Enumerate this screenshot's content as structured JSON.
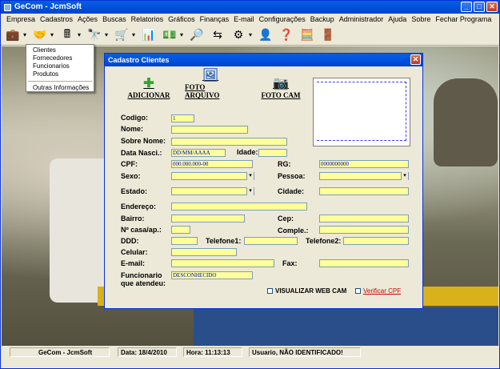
{
  "window": {
    "title": "GeCom - JcmSoft"
  },
  "menubar": [
    "Empresa",
    "Cadastros",
    "Ações",
    "Buscas",
    "Relatorios",
    "Gráficos",
    "Finanças",
    "E-mail",
    "Configurações",
    "Backup",
    "Administrador",
    "Ajuda",
    "Sobre",
    "Fechar Programa"
  ],
  "toolbar_icons": [
    "briefcase-icon",
    "handshake-icon",
    "cash-register-icon",
    "binoculars-icon",
    "cart-icon",
    "chart-icon",
    "money-icon",
    "search-people-icon",
    "transfer-icon",
    "settings-icon",
    "user-card-icon",
    "help-icon",
    "calculator-icon",
    "exit-door-icon"
  ],
  "cadastros_menu": {
    "items": [
      "Clientes",
      "Fornecedores",
      "Funcionarios",
      "Produtos"
    ],
    "extra": "Outras Informações"
  },
  "dialog": {
    "title": "Cadastro Clientes",
    "buttons": {
      "add": "ADICIONAR",
      "photo_file": "FOTO ARQUIVO",
      "photo_cam": "FOTO CAM"
    },
    "labels": {
      "codigo": "Codigo:",
      "nome": "Nome:",
      "sobrenome": "Sobre Nome:",
      "data_nasc": "Data Nasci.:",
      "idade": "Idade:",
      "cpf": "CPF:",
      "rg": "RG:",
      "sexo": "Sexo:",
      "pessoa": "Pessoa:",
      "estado": "Estado:",
      "cidade": "Cidade:",
      "endereco": "Endereço:",
      "bairro": "Bairro:",
      "cep": "Cep:",
      "numero": "Nº casa/ap.:",
      "complemento": "Comple.:",
      "ddd": "DDD:",
      "telefone1": "Telefone1:",
      "telefone2": "Telefone2:",
      "celular": "Celular:",
      "email": "E-mail:",
      "fax": "Fax:",
      "funcionario_1": "Funcionario",
      "funcionario_2": "que atendeu:"
    },
    "values": {
      "codigo": "1",
      "data_nasc": "DD/MM/AAAA",
      "cpf": "000.000.000-00",
      "rg": "0000000000",
      "funcionario": "DESCONHECIDO"
    },
    "visualizar_webcam": "VISUALIZAR WEB CAM",
    "verificar_cpf": "Verificar CPF"
  },
  "statusbar": {
    "app": "GeCom - JcmSoft",
    "date": "Data: 18/4/2010",
    "time": "Hora: 11:13:13",
    "user": "Usuario, NÃO IDENTIFICADO!"
  }
}
